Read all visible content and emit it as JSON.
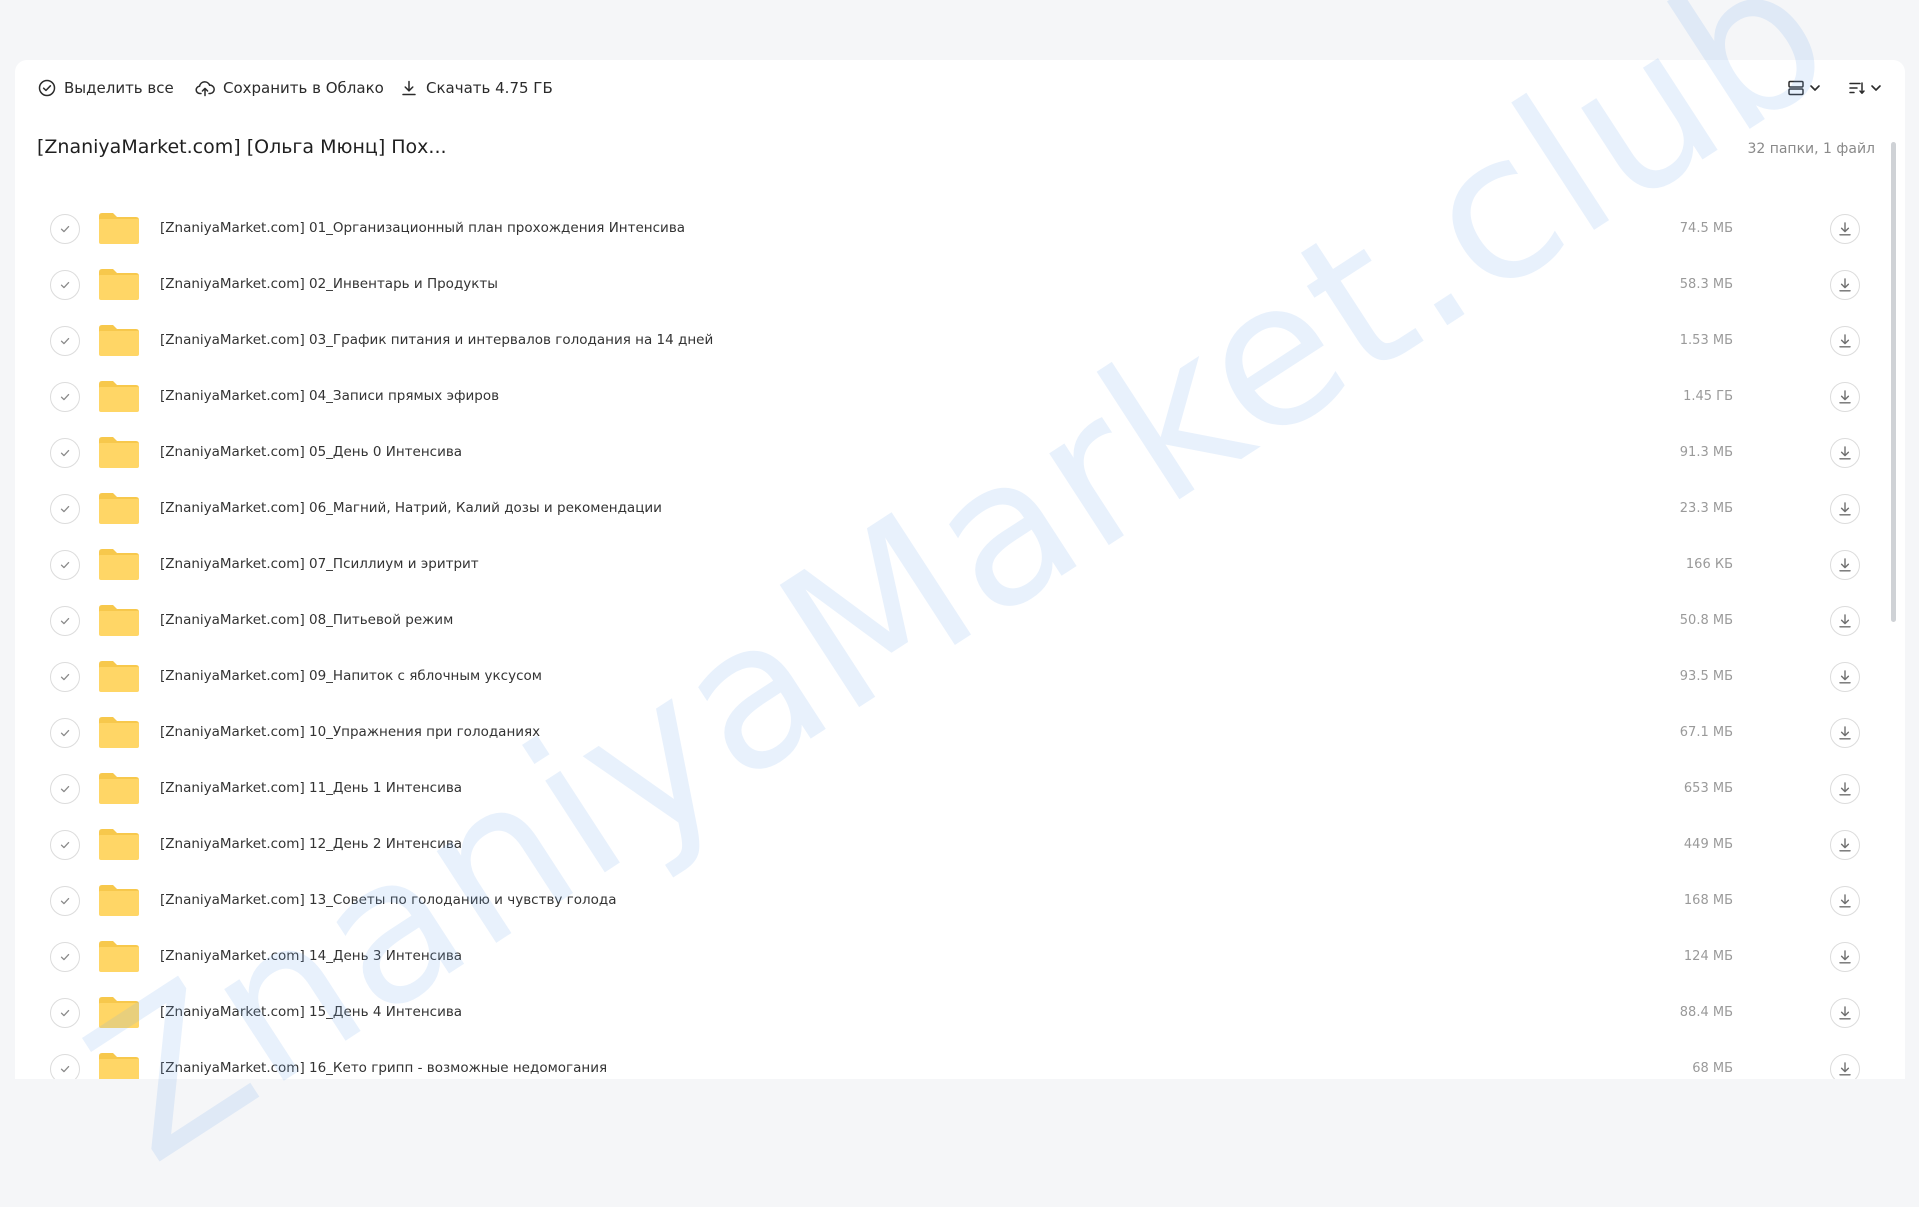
{
  "toolbar": {
    "select_all_label": "Выделить все",
    "save_cloud_label": "Сохранить в Облако",
    "download_label": "Скачать 4.75 ГБ"
  },
  "header": {
    "title": "[ZnaniyaMarket.com] [Ольга Мюнц] Пох...",
    "summary": "32 папки, 1 файл"
  },
  "items": [
    {
      "name": "[ZnaniyaMarket.com] 01_Организационный план прохождения Интенсива",
      "size": "74.5 МБ"
    },
    {
      "name": "[ZnaniyaMarket.com] 02_Инвентарь и Продукты",
      "size": "58.3 МБ"
    },
    {
      "name": "[ZnaniyaMarket.com] 03_График питания и интервалов голодания на 14 дней",
      "size": "1.53 МБ"
    },
    {
      "name": "[ZnaniyaMarket.com] 04_Записи прямых эфиров",
      "size": "1.45 ГБ"
    },
    {
      "name": "[ZnaniyaMarket.com] 05_День 0 Интенсива",
      "size": "91.3 МБ"
    },
    {
      "name": "[ZnaniyaMarket.com] 06_Магний, Натрий, Калий дозы и рекомендации",
      "size": "23.3 МБ"
    },
    {
      "name": "[ZnaniyaMarket.com] 07_Псиллиум и эритрит",
      "size": "166 КБ"
    },
    {
      "name": "[ZnaniyaMarket.com] 08_Питьевой режим",
      "size": "50.8 МБ"
    },
    {
      "name": "[ZnaniyaMarket.com] 09_Напиток с яблочным уксусом",
      "size": "93.5 МБ"
    },
    {
      "name": "[ZnaniyaMarket.com] 10_Упражнения при голоданиях",
      "size": "67.1 МБ"
    },
    {
      "name": "[ZnaniyaMarket.com] 11_День 1 Интенсива",
      "size": "653 МБ"
    },
    {
      "name": "[ZnaniyaMarket.com] 12_День 2 Интенсива",
      "size": "449 МБ"
    },
    {
      "name": "[ZnaniyaMarket.com] 13_Советы по голоданию и чувству голода",
      "size": "168 МБ"
    },
    {
      "name": "[ZnaniyaMarket.com] 14_День 3 Интенсива",
      "size": "124 МБ"
    },
    {
      "name": "[ZnaniyaMarket.com] 15_День 4 Интенсива",
      "size": "88.4 МБ"
    },
    {
      "name": "[ZnaniyaMarket.com] 16_Кето грипп - возможные недомогания",
      "size": "68 МБ"
    }
  ],
  "watermark": "ZnaniyaMarket.club",
  "icons": {
    "select_all": "check-circle-icon",
    "save_cloud": "cloud-upload-icon",
    "download": "download-icon",
    "view_mode": "list-view-icon",
    "sort": "sort-icon",
    "folder": "folder-icon"
  },
  "colors": {
    "folder": "#ffd666",
    "folder_tab": "#f7c84c",
    "background": "#f5f6f8",
    "panel": "#ffffff",
    "watermark": "#78aaeb"
  }
}
